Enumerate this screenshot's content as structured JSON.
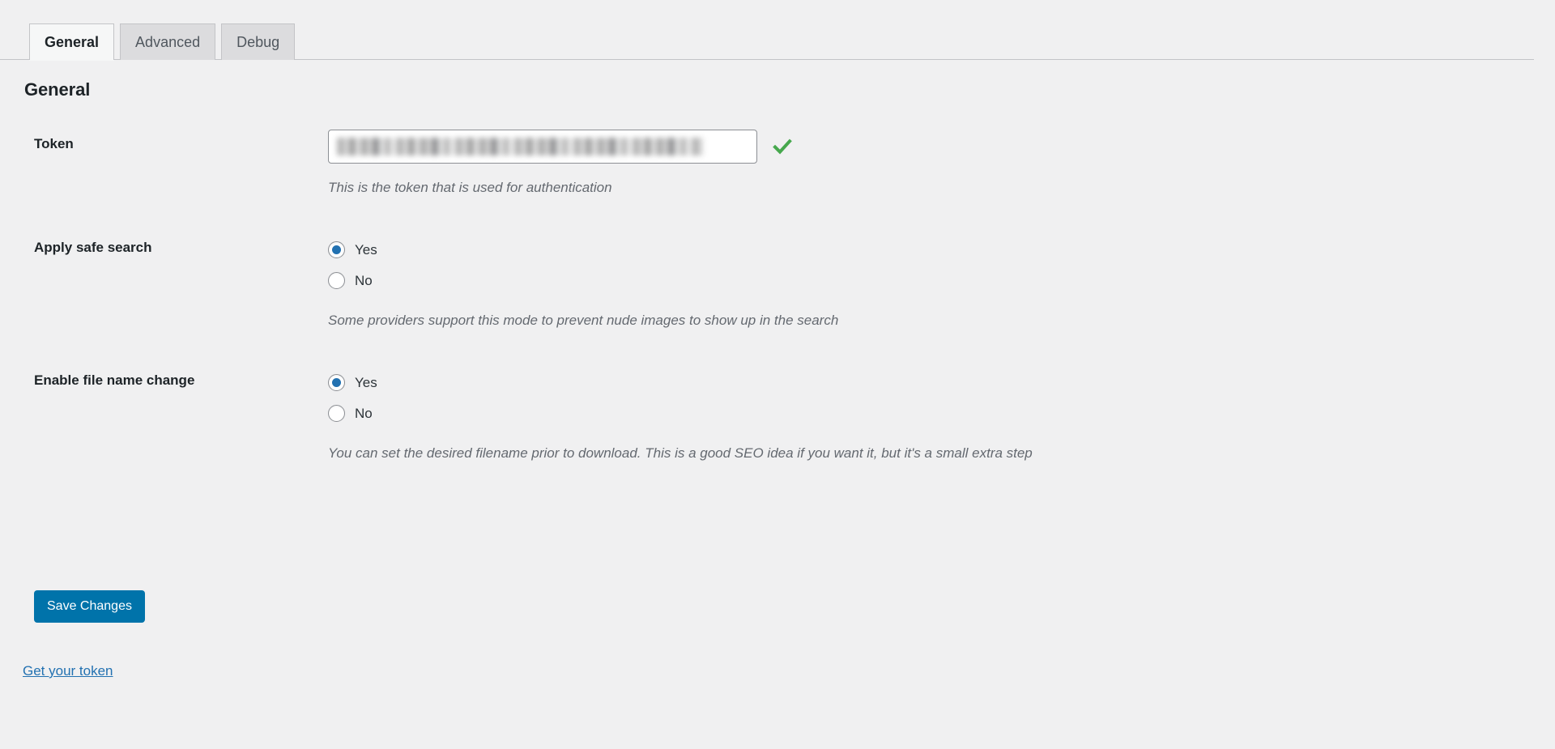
{
  "tabs": [
    {
      "label": "General",
      "active": true
    },
    {
      "label": "Advanced",
      "active": false
    },
    {
      "label": "Debug",
      "active": false
    }
  ],
  "section": {
    "heading": "General"
  },
  "fields": {
    "token": {
      "label": "Token",
      "value": "",
      "placeholder": "",
      "redacted": true,
      "description": "This is the token that is used for authentication",
      "status_icon": "green-checkmark-icon",
      "status_color": "#46a84d"
    },
    "safe_search": {
      "label": "Apply safe search",
      "description": "Some providers support this mode to prevent nude images to show up in the search",
      "options": [
        {
          "label": "Yes",
          "selected": true
        },
        {
          "label": "No",
          "selected": false
        }
      ]
    },
    "file_name_change": {
      "label": "Enable file name change",
      "description": "You can set the desired filename prior to download. This is a good SEO idea if you want it, but it's a small extra step",
      "options": [
        {
          "label": "Yes",
          "selected": true
        },
        {
          "label": "No",
          "selected": false
        }
      ]
    }
  },
  "actions": {
    "save_label": "Save Changes",
    "get_token_link": "Get your token"
  },
  "colors": {
    "accent": "#2271b1",
    "button": "#0073aa",
    "success": "#46a84d",
    "background": "#f0f0f1"
  }
}
